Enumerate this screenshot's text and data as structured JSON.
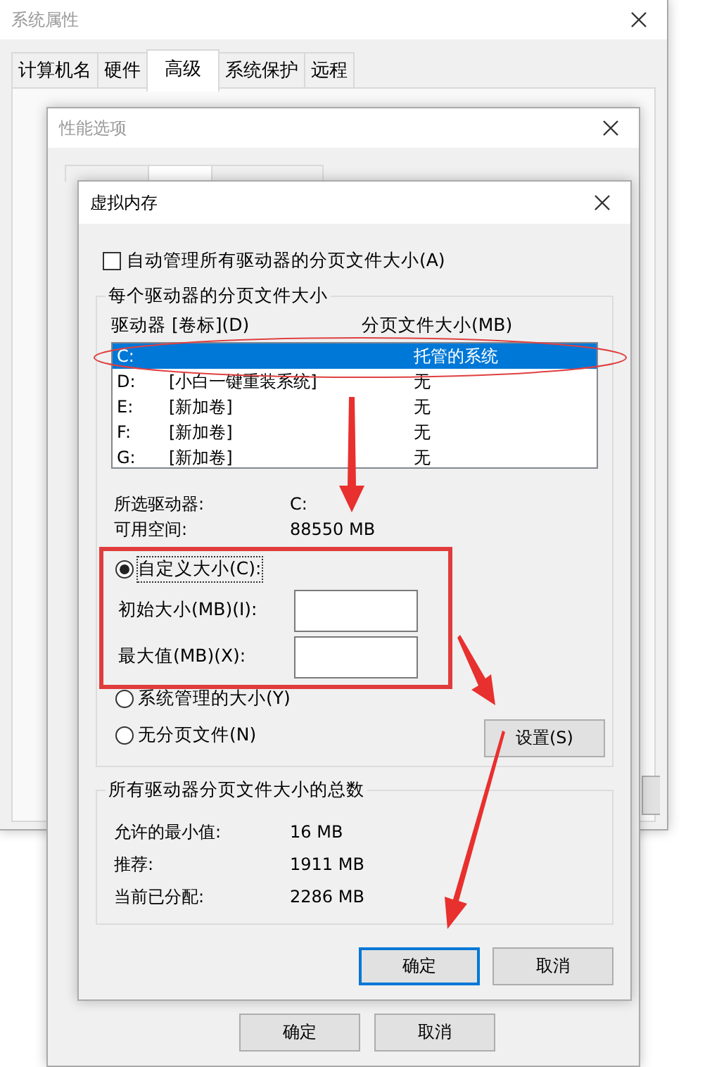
{
  "system_properties": {
    "title": "系统属性",
    "tabs": [
      {
        "label": "计算机名",
        "selected": false
      },
      {
        "label": "硬件",
        "selected": false
      },
      {
        "label": "高级",
        "selected": true
      },
      {
        "label": "系统保护",
        "selected": false
      },
      {
        "label": "远程",
        "selected": false
      }
    ]
  },
  "performance_options": {
    "title": "性能选项",
    "tabs": [
      {
        "selected": false
      },
      {
        "selected": true
      },
      {
        "selected": false
      }
    ],
    "buttons": [
      "确定",
      "取消"
    ]
  },
  "virtual_memory": {
    "title": "虚拟内存",
    "auto_manage": {
      "label": "自动管理所有驱动器的分页文件大小(A)",
      "checked": false
    },
    "drives_group": {
      "legend": "每个驱动器的分页文件大小",
      "columns": [
        "驱动器 [卷标](D)",
        "分页文件大小(MB)"
      ],
      "drives": [
        {
          "drive": "C:",
          "size": "托管的系统",
          "selected": true
        },
        {
          "drive": "D:",
          "label": "[小白一键重装系统]",
          "size": "无",
          "selected": false
        },
        {
          "drive": "E:",
          "label": "[新加卷]",
          "size": "无",
          "selected": false
        },
        {
          "drive": "F:",
          "label": "[新加卷]",
          "size": "无",
          "selected": false
        },
        {
          "drive": "G:",
          "label": "[新加卷]",
          "size": "无",
          "selected": false
        }
      ],
      "info": [
        {
          "label": "所选驱动器:",
          "value": "C:"
        },
        {
          "label": "可用空间:",
          "value": "88550 MB"
        }
      ],
      "options": [
        {
          "kind": "custom",
          "label": "自定义大小(C):",
          "selected": true,
          "fields": [
            {
              "label": "初始大小(MB)(I):"
            },
            {
              "label": "最大值(MB)(X):"
            }
          ]
        },
        {
          "kind": "plain",
          "label": "系统管理的大小(Y)",
          "selected": false
        },
        {
          "kind": "plain",
          "label": "无分页文件(N)",
          "selected": false
        }
      ],
      "set_button": "设置(S)"
    },
    "totals_group": {
      "legend": "所有驱动器分页文件大小的总数",
      "rows": [
        {
          "label": "允许的最小值:",
          "value": "16 MB"
        },
        {
          "label": "推荐:",
          "value": "1911 MB"
        },
        {
          "label": "当前已分配:",
          "value": "2286 MB"
        }
      ]
    },
    "buttons": [
      {
        "label": "确定",
        "default": true
      },
      {
        "label": "取消",
        "default": false
      }
    ]
  }
}
